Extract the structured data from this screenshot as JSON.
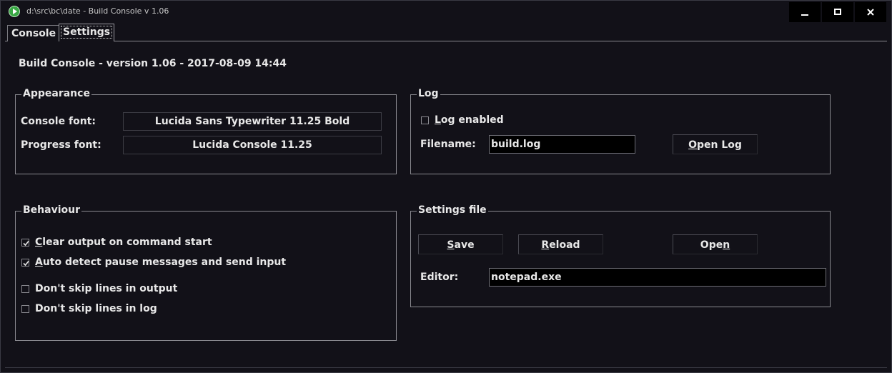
{
  "window": {
    "title": "d:\\src\\bc\\date - Build Console v 1.06",
    "icon": "play-icon",
    "controls": [
      "minimize-icon",
      "maximize-icon",
      "close-icon"
    ]
  },
  "tabs": [
    {
      "label": "Console",
      "selected": false
    },
    {
      "label": "Settings",
      "selected": true
    }
  ],
  "version_text": "Build Console - version 1.06 - 2017-08-09 14:44",
  "appearance": {
    "title": "Appearance",
    "console_font_label": "Console font:",
    "console_font_value": "Lucida Sans Typewriter 11.25 Bold",
    "progress_font_label": "Progress font:",
    "progress_font_value": "Lucida Console 11.25"
  },
  "behaviour": {
    "title": "Behaviour",
    "options": [
      {
        "label_hot": "C",
        "label_rest": "lear output on command start",
        "checked": true
      },
      {
        "label_hot": "A",
        "label_rest": "uto detect pause messages and send input",
        "checked": true
      },
      {
        "label_hot": "",
        "label_rest": "Don't skip lines in output",
        "checked": false
      },
      {
        "label_hot": "",
        "label_rest": "Don't skip lines in log",
        "checked": false
      }
    ]
  },
  "log": {
    "title": "Log",
    "enabled_hot": "L",
    "enabled_rest": "og enabled",
    "enabled": false,
    "filename_label": "Filename:",
    "filename_value": "build.log",
    "open_log_hot": "O",
    "open_log_rest": "pen Log"
  },
  "settings_file": {
    "title": "Settings file",
    "save_hot": "S",
    "save_rest": "ave",
    "reload_hot": "R",
    "reload_rest": "eload",
    "open_pre": "Ope",
    "open_hot": "n",
    "editor_label": "Editor:",
    "editor_value": "notepad.exe"
  },
  "colors": {
    "background": "#121118",
    "text": "#e8e8e8",
    "app_icon": "#3aa845"
  }
}
